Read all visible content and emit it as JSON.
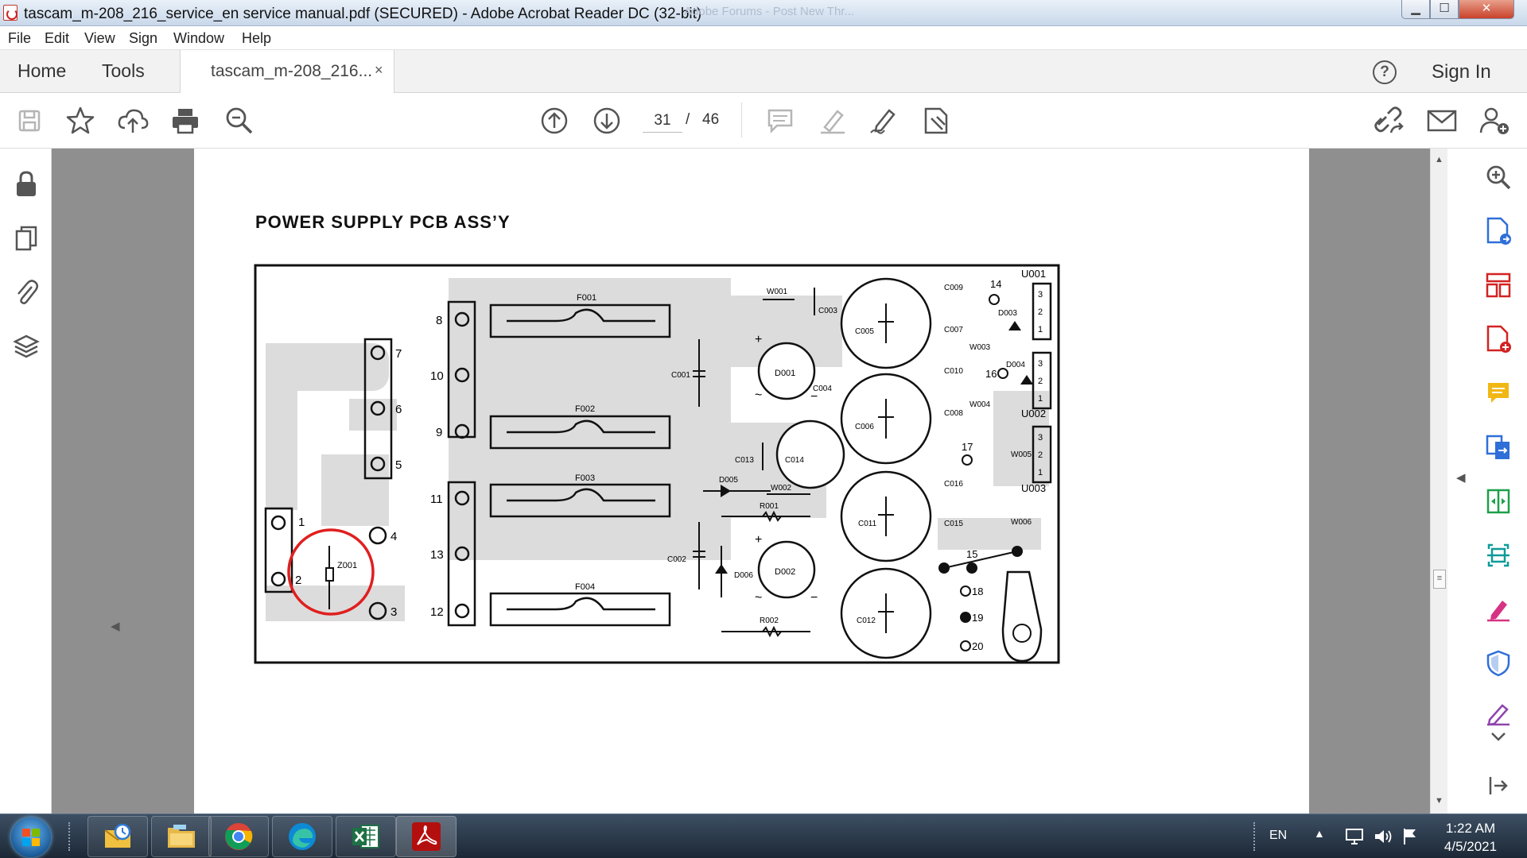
{
  "window": {
    "title": "tascam_m-208_216_service_en service manual.pdf (SECURED) - Adobe Acrobat Reader DC (32-bit)",
    "background_tab_hint": "Adobe Forums - Post New Thr...",
    "minimize": "▁",
    "maximize": "☐",
    "close": "✕"
  },
  "menu": [
    "File",
    "Edit",
    "View",
    "Sign",
    "Window",
    "Help"
  ],
  "tabs": {
    "home": "Home",
    "tools": "Tools",
    "document": "tascam_m-208_216...",
    "close_glyph": "×",
    "help": "?",
    "sign_in": "Sign In"
  },
  "toolbar": {
    "icons": [
      "save-icon",
      "star-icon",
      "cloud-upload-icon",
      "print-icon",
      "zoom-search-icon",
      "page-up-icon",
      "page-down-icon",
      "comment-icon",
      "highlight-icon",
      "sign-pen-icon",
      "stamp-icon",
      "share-link-icon",
      "email-icon",
      "add-user-icon"
    ],
    "current_page": "31",
    "separator": "/",
    "total_pages": "46"
  },
  "left_rail": [
    "lock-icon",
    "pages-icon",
    "attachment-icon",
    "layers-icon"
  ],
  "right_rail": [
    "zoom-in-icon",
    "export-pdf-icon",
    "organize-pages-icon",
    "create-pdf-icon",
    "comment-tool-icon",
    "combine-icon",
    "compress-icon",
    "scan-icon",
    "fill-sign-icon",
    "protect-icon",
    "edit-pen-icon",
    "expand-icon",
    "collapse-panel-icon"
  ],
  "document": {
    "heading": "POWER SUPPLY PCB ASS’Y",
    "connector_left": [
      "7",
      "6",
      "5",
      "4",
      "3",
      "1",
      "2"
    ],
    "connector_mid": [
      "8",
      "10",
      "9",
      "11",
      "13",
      "12"
    ],
    "fuses": [
      "F001",
      "F002",
      "F003",
      "F004"
    ],
    "components": {
      "z001": "Z001",
      "c001": "C001",
      "c002": "C002",
      "c003": "C003",
      "c004": "C004",
      "c005": "C005",
      "c006": "C006",
      "c007": "C007",
      "c008": "C008",
      "c009": "C009",
      "c010": "C010",
      "c011": "C011",
      "c012": "C012",
      "c013": "C013",
      "c014": "C014",
      "c015": "C015",
      "c016": "C016",
      "d001": "D001",
      "d002": "D002",
      "d003": "D003",
      "d004": "D004",
      "d005": "D005",
      "d006": "D006",
      "r001": "R001",
      "r002": "R002",
      "w001": "W001",
      "w002": "W002",
      "w003": "W003",
      "w004": "W004",
      "w005": "W005",
      "w006": "W006",
      "u001": "U001",
      "u002": "U002",
      "u003": "U003"
    },
    "terminals": [
      "14",
      "15",
      "16",
      "17",
      "18",
      "19",
      "20"
    ],
    "pin_labels": [
      "3",
      "2",
      "1"
    ],
    "plus": "+",
    "minus": "−",
    "tilde": "~"
  },
  "taskbar": {
    "apps": [
      "outlook-icon",
      "file-explorer-icon",
      "chrome-icon",
      "edge-icon",
      "excel-icon",
      "acrobat-icon"
    ],
    "language": "EN",
    "time": "1:22 AM",
    "date": "4/5/2021"
  },
  "colors": {
    "accent_red": "#d32222",
    "acrobat_red": "#b40f0f",
    "rail_icon_blue": "#2f6fd8",
    "annotation_circle": "#e01f1f"
  }
}
